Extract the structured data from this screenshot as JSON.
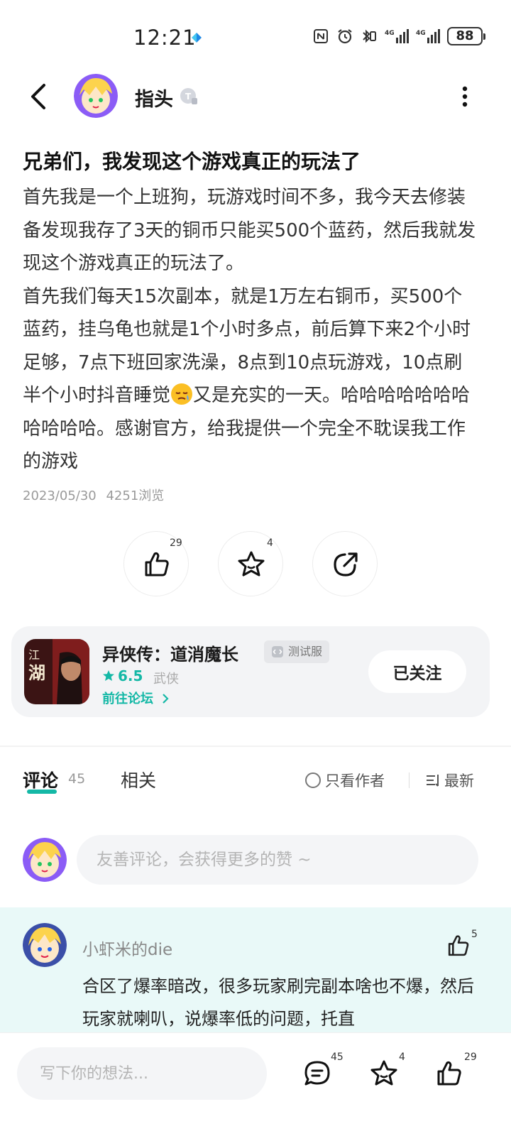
{
  "status_bar": {
    "time": "12:21",
    "battery": "88",
    "network_labels": [
      "4G",
      "4G"
    ]
  },
  "header": {
    "author_name": "指头",
    "icons": [
      "back-arrow-icon",
      "avatar",
      "user-level-badge-icon",
      "more-vertical-icon"
    ]
  },
  "post": {
    "title": "兄弟们，我发现这个游戏真正的玩法了",
    "paragraph_1": "首先我是一个上班狗，玩游戏时间不多，我今天去修装备发现我存了3天的铜币只能买500个蓝药，然后我就发现这个游戏真正的玩法了。",
    "paragraph_2_before_emoji": "首先我们每天15次副本，就是1万左右铜币，买500个蓝药，挂乌龟也就是1个小时多点，前后算下来2个小时足够，7点下班回家洗澡，8点到10点玩游戏，10点刷半个小时抖音睡觉",
    "paragraph_2_after_emoji": "又是充实的一天。哈哈哈哈哈哈哈哈哈哈哈。感谢官方，给我提供一个完全不耽误我工作的游戏",
    "date": "2023/05/30",
    "views": "4251浏览"
  },
  "actions": {
    "like_count": "29",
    "favorite_count": "4",
    "share_icon": "share-icon"
  },
  "game": {
    "name": "异侠传：道消魔长",
    "tag": "测试服",
    "rating": "6.5",
    "genre": "武侠",
    "goto_forum": "前往论坛",
    "follow_label": "已关注"
  },
  "tabs": {
    "comment_label": "评论",
    "comment_count": "45",
    "related_label": "相关",
    "only_author_label": "只看作者",
    "sort_label": "最新"
  },
  "comment_input": {
    "placeholder": "友善评论，会获得更多的赞 ~"
  },
  "comments": [
    {
      "username": "小虾米的die",
      "likes": "5",
      "text": "合区了爆率暗改，很多玩家刷完副本啥也不爆，然后玩家就喇叭，说爆率低的问题，托直"
    }
  ],
  "bottom_bar": {
    "placeholder": "写下你的想法...",
    "comment_count": "45",
    "favorite_count": "4",
    "like_count": "29"
  },
  "colors": {
    "accent": "#14b8a6",
    "comment_highlight_bg": "#e9f9f8",
    "card_bg": "#f3f4f6"
  }
}
